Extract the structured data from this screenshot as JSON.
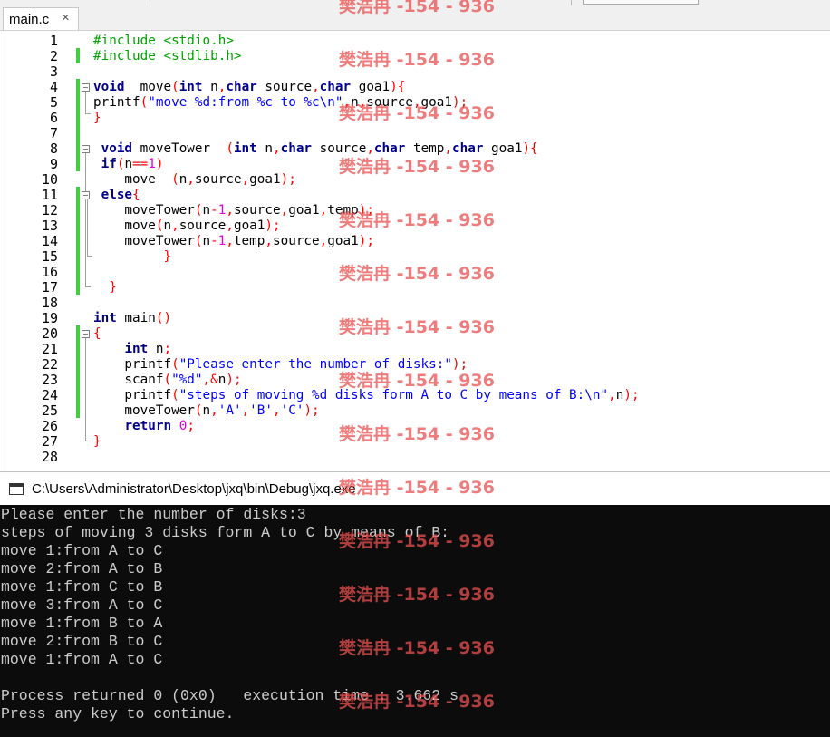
{
  "tab": {
    "label": "main.c",
    "close": "×"
  },
  "editor": {
    "line_numbers": [
      "1",
      "2",
      "3",
      "4",
      "5",
      "6",
      "7",
      "8",
      "9",
      "10",
      "11",
      "12",
      "13",
      "14",
      "15",
      "16",
      "17",
      "18",
      "19",
      "20",
      "21",
      "22",
      "23",
      "24",
      "25",
      "26",
      "27",
      "28"
    ],
    "lines": [
      [
        [
          "pp",
          "#include <stdio.h>"
        ]
      ],
      [
        [
          "pp",
          "#include <stdlib.h>"
        ]
      ],
      [],
      [
        [
          "kw",
          "void"
        ],
        [
          "",
          "  move"
        ],
        [
          "op",
          "("
        ],
        [
          "kw",
          "int"
        ],
        [
          "",
          " n"
        ],
        [
          "op",
          ","
        ],
        [
          "kw",
          "char"
        ],
        [
          "",
          " source"
        ],
        [
          "op",
          ","
        ],
        [
          "kw",
          "char"
        ],
        [
          "",
          " goa1"
        ],
        [
          "op",
          ")"
        ],
        [
          "op",
          "{"
        ]
      ],
      [
        [
          "",
          "printf"
        ],
        [
          "op",
          "("
        ],
        [
          "str",
          "\"move %d:from %c to %c\\n\""
        ],
        [
          "op",
          ","
        ],
        [
          "",
          "n"
        ],
        [
          "op",
          ","
        ],
        [
          "",
          "source"
        ],
        [
          "op",
          ","
        ],
        [
          "",
          "goa1"
        ],
        [
          "op",
          ")"
        ],
        [
          "op",
          ";"
        ]
      ],
      [
        [
          "op",
          "}"
        ]
      ],
      [],
      [
        [
          "",
          ""
        ],
        [
          "kw",
          " void"
        ],
        [
          "",
          " moveTower  "
        ],
        [
          "op",
          "("
        ],
        [
          "kw",
          "int"
        ],
        [
          "",
          " n"
        ],
        [
          "op",
          ","
        ],
        [
          "kw",
          "char"
        ],
        [
          "",
          " source"
        ],
        [
          "op",
          ","
        ],
        [
          "kw",
          "char"
        ],
        [
          "",
          " temp"
        ],
        [
          "op",
          ","
        ],
        [
          "kw",
          "char"
        ],
        [
          "",
          " goa1"
        ],
        [
          "op",
          ")"
        ],
        [
          "op",
          "{"
        ]
      ],
      [
        [
          "",
          ""
        ],
        [
          "kw",
          " if"
        ],
        [
          "op",
          "("
        ],
        [
          "",
          "n"
        ],
        [
          "op",
          "=="
        ],
        [
          "num",
          "1"
        ],
        [
          "op",
          ")"
        ]
      ],
      [
        [
          "",
          "    move  "
        ],
        [
          "op",
          "("
        ],
        [
          "",
          "n"
        ],
        [
          "op",
          ","
        ],
        [
          "",
          "source"
        ],
        [
          "op",
          ","
        ],
        [
          "",
          "goa1"
        ],
        [
          "op",
          ")"
        ],
        [
          "op",
          ";"
        ]
      ],
      [
        [
          "",
          ""
        ],
        [
          "kw",
          " else"
        ],
        [
          "op",
          "{"
        ]
      ],
      [
        [
          "",
          "    moveTower"
        ],
        [
          "op",
          "("
        ],
        [
          "",
          "n"
        ],
        [
          "op",
          "-"
        ],
        [
          "num",
          "1"
        ],
        [
          "op",
          ","
        ],
        [
          "",
          "source"
        ],
        [
          "op",
          ","
        ],
        [
          "",
          "goa1"
        ],
        [
          "op",
          ","
        ],
        [
          "",
          "temp"
        ],
        [
          "op",
          ")"
        ],
        [
          "op",
          ";"
        ]
      ],
      [
        [
          "",
          "    move"
        ],
        [
          "op",
          "("
        ],
        [
          "",
          "n"
        ],
        [
          "op",
          ","
        ],
        [
          "",
          "source"
        ],
        [
          "op",
          ","
        ],
        [
          "",
          "goa1"
        ],
        [
          "op",
          ")"
        ],
        [
          "op",
          ";"
        ]
      ],
      [
        [
          "",
          "    moveTower"
        ],
        [
          "op",
          "("
        ],
        [
          "",
          "n"
        ],
        [
          "op",
          "-"
        ],
        [
          "num",
          "1"
        ],
        [
          "op",
          ","
        ],
        [
          "",
          "temp"
        ],
        [
          "op",
          ","
        ],
        [
          "",
          "source"
        ],
        [
          "op",
          ","
        ],
        [
          "",
          "goa1"
        ],
        [
          "op",
          ")"
        ],
        [
          "op",
          ";"
        ]
      ],
      [
        [
          "",
          "         "
        ],
        [
          "op",
          "}"
        ]
      ],
      [],
      [
        [
          "",
          "  "
        ],
        [
          "op",
          "}"
        ]
      ],
      [],
      [
        [
          "",
          ""
        ],
        [
          "kw",
          "int"
        ],
        [
          "",
          " main"
        ],
        [
          "op",
          "()"
        ]
      ],
      [
        [
          "op",
          "{"
        ]
      ],
      [
        [
          "",
          "    "
        ],
        [
          "kw",
          "int"
        ],
        [
          "",
          " n"
        ],
        [
          "op",
          ";"
        ]
      ],
      [
        [
          "",
          "    printf"
        ],
        [
          "op",
          "("
        ],
        [
          "str",
          "\"Please enter the number of disks:\""
        ],
        [
          "op",
          ")"
        ],
        [
          "op",
          ";"
        ]
      ],
      [
        [
          "",
          "    scanf"
        ],
        [
          "op",
          "("
        ],
        [
          "str",
          "\"%d\""
        ],
        [
          "op",
          ","
        ],
        [
          "op",
          "&"
        ],
        [
          "",
          "n"
        ],
        [
          "op",
          ")"
        ],
        [
          "op",
          ";"
        ]
      ],
      [
        [
          "",
          "    printf"
        ],
        [
          "op",
          "("
        ],
        [
          "str",
          "\"steps of moving %d disks form A to C by means of B:\\n\""
        ],
        [
          "op",
          ","
        ],
        [
          "",
          "n"
        ],
        [
          "op",
          ")"
        ],
        [
          "op",
          ";"
        ]
      ],
      [
        [
          "",
          "    moveTower"
        ],
        [
          "op",
          "("
        ],
        [
          "",
          "n"
        ],
        [
          "op",
          ","
        ],
        [
          "ch",
          "'A'"
        ],
        [
          "op",
          ","
        ],
        [
          "ch",
          "'B'"
        ],
        [
          "op",
          ","
        ],
        [
          "ch",
          "'C'"
        ],
        [
          "op",
          ")"
        ],
        [
          "op",
          ";"
        ]
      ],
      [
        [
          "",
          "    "
        ],
        [
          "kw",
          "return"
        ],
        [
          "",
          " "
        ],
        [
          "num",
          "0"
        ],
        [
          "op",
          ";"
        ]
      ],
      [
        [
          "op",
          "}"
        ]
      ],
      []
    ]
  },
  "console": {
    "title": "C:\\Users\\Administrator\\Desktop\\jxq\\bin\\Debug\\jxq.exe",
    "lines": [
      "Please enter the number of disks:3",
      "steps of moving 3 disks form A to C by means of B:",
      "move 1:from A to C",
      "move 2:from A to B",
      "move 1:from C to B",
      "move 3:from A to C",
      "move 1:from B to A",
      "move 2:from B to C",
      "move 1:from A to C",
      "",
      "Process returned 0 (0x0)   execution time : 3.662 s",
      "Press any key to continue."
    ]
  },
  "watermark": {
    "text": "樊浩冉 -154 - 936",
    "count": 14
  },
  "colors": {
    "keyword": "#00008b",
    "preprocessor": "#00a000",
    "string": "#0000ff",
    "number": "#e000e0",
    "operator": "#ff0000",
    "change_bar": "#3fcf3f",
    "console_bg": "#0c0c0c",
    "console_fg": "#cccccc",
    "watermark": "#e85050"
  }
}
